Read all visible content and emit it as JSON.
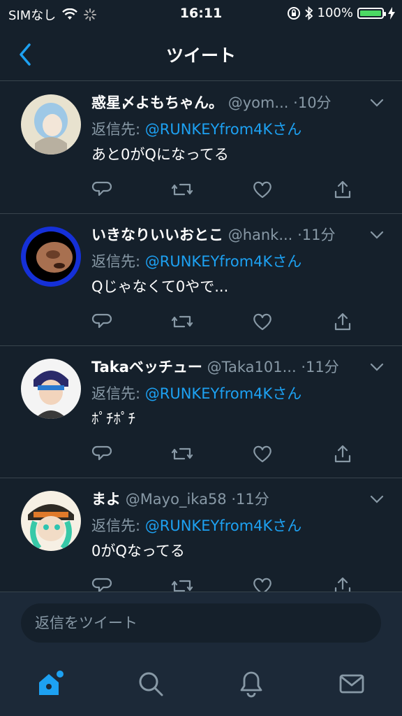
{
  "status_bar": {
    "carrier": "SIMなし",
    "time": "16:11",
    "battery": "100%",
    "battery_level": 1.0
  },
  "nav": {
    "title": "ツイート"
  },
  "tweets": [
    {
      "name": "惑星〆よもちゃん。",
      "handle": "@yom...",
      "time": "10分",
      "reply_prefix": "返信先:",
      "reply_to": "@RUNKEYfrom4Kさん",
      "text": "あと0がQになってる"
    },
    {
      "name": "いきなりいいおとこ",
      "handle": "@hank...",
      "time": "11分",
      "reply_prefix": "返信先:",
      "reply_to": "@RUNKEYfrom4Kさん",
      "text": "Qじゃなくて0やで..."
    },
    {
      "name": "Takaベッチュー",
      "handle": "@Taka101...",
      "time": "11分",
      "reply_prefix": "返信先:",
      "reply_to": "@RUNKEYfrom4Kさん",
      "text": "ﾎﾟﾁﾎﾟﾁ"
    },
    {
      "name": "まよ",
      "handle": "@Mayo_ika58",
      "time": "11分",
      "reply_prefix": "返信先:",
      "reply_to": "@RUNKEYfrom4Kさん",
      "text": "0がQなってる"
    }
  ],
  "compose": {
    "placeholder": "返信をツイート"
  },
  "colors": {
    "background": "#15202b",
    "accent": "#1da1f2",
    "secondary_text": "#8899a6",
    "divider": "#38444d",
    "battery_green": "#4cd964"
  },
  "icons": {
    "back": "chevron-left-icon",
    "reply": "reply-icon",
    "retweet": "retweet-icon",
    "like": "heart-icon",
    "share": "share-icon",
    "home": "home-icon",
    "search": "search-icon",
    "notifications": "bell-icon",
    "messages": "mail-icon"
  }
}
